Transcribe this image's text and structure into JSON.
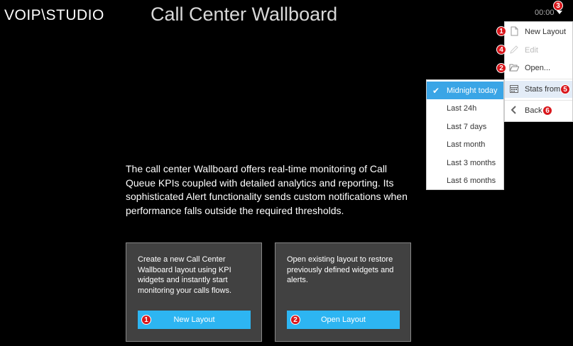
{
  "header": {
    "logo": "VOIP\\STUDIO",
    "title": "Call Center Wallboard",
    "clock": "00:00",
    "badge_menu": "3"
  },
  "main_menu": {
    "items": [
      {
        "label": "New Layout",
        "icon": "file-icon",
        "badge": "1",
        "disabled": false
      },
      {
        "label": "Edit",
        "icon": "pencil-icon",
        "badge": "4",
        "disabled": true
      },
      {
        "label": "Open...",
        "icon": "folder-open-icon",
        "badge": "2",
        "disabled": false
      },
      {
        "label": "Stats from",
        "icon": "calendar-icon",
        "badge": "5",
        "disabled": false
      },
      {
        "label": "Back",
        "icon": "chevron-left-icon",
        "badge": "6",
        "disabled": false
      }
    ]
  },
  "stats_submenu": {
    "selected": "Midnight today",
    "items": [
      "Midnight today",
      "Last 24h",
      "Last 7 days",
      "Last month",
      "Last 3 months",
      "Last 6 months"
    ]
  },
  "description": "The call center Wallboard offers real-time monitoring of Call Queue KPIs coupled with detailed analytics and reporting. Its sophisticated Alert functionality sends custom notifications when performance falls outside the required thresholds.",
  "cards": [
    {
      "text": "Create a new Call Center Wallboard layout using KPI widgets and instantly start monitoring your calls flows.",
      "button": "New Layout",
      "badge": "1"
    },
    {
      "text": "Open existing layout to restore previously defined widgets and alerts.",
      "button": "Open Layout",
      "badge": "2"
    }
  ],
  "colors": {
    "accent": "#2db5f2",
    "selected": "#3aa5e6",
    "badge": "#d9171c",
    "card_bg": "#414141"
  }
}
